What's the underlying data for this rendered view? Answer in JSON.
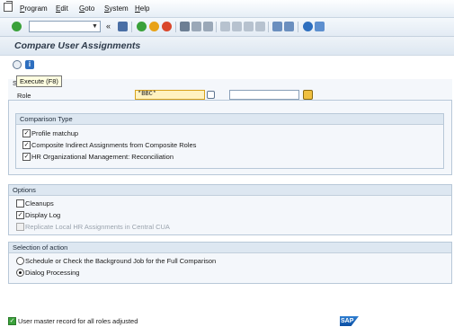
{
  "menubar": {
    "items": [
      "Program",
      "Edit",
      "Goto",
      "System",
      "Help"
    ],
    "underline": [
      "P",
      "E",
      "G",
      "S",
      "H"
    ]
  },
  "toolbar": {
    "command_field_value": "",
    "icons": [
      "enter-icon",
      "save-icon",
      "back-icon",
      "exit-icon",
      "cancel-icon",
      "print-icon",
      "find-icon",
      "find-next-icon",
      "first-page-icon",
      "previous-page-icon",
      "next-page-icon",
      "last-page-icon",
      "new-session-icon",
      "shortcut-icon",
      "help-icon",
      "layout-icon"
    ]
  },
  "title": "Compare User Assignments",
  "app_toolbar": {
    "execute_tooltip": "Execute   (F8)"
  },
  "selection": {
    "group_label_visible": "Se",
    "role_label": "Role",
    "role_value": "*BBC*",
    "role_to_value": ""
  },
  "comparison_type": {
    "title": "Comparison Type",
    "options": [
      {
        "label": "Profile matchup",
        "checked": true
      },
      {
        "label": "Composite Indirect Assignments from Composite Roles",
        "checked": true
      },
      {
        "label": "HR Organizational Management: Reconciliation",
        "checked": true
      }
    ]
  },
  "options": {
    "title": "Options",
    "items": [
      {
        "label": "Cleanups",
        "checked": false,
        "disabled": false
      },
      {
        "label": "Display Log",
        "checked": true,
        "disabled": false
      },
      {
        "label": "Replicate Local HR Assignments in Central CUA",
        "checked": false,
        "disabled": true
      }
    ]
  },
  "selection_of_action": {
    "title": "Selection of action",
    "items": [
      {
        "label": "Schedule or Check the Background Job for the Full Comparison",
        "selected": false
      },
      {
        "label": "Dialog Processing",
        "selected": true
      }
    ]
  },
  "status": {
    "message": "User master record for all roles adjusted",
    "brand": "SAP"
  },
  "colors": {
    "accent": "#d8a21c",
    "success": "#3aa13a",
    "frame_border": "#b8c8d8"
  }
}
